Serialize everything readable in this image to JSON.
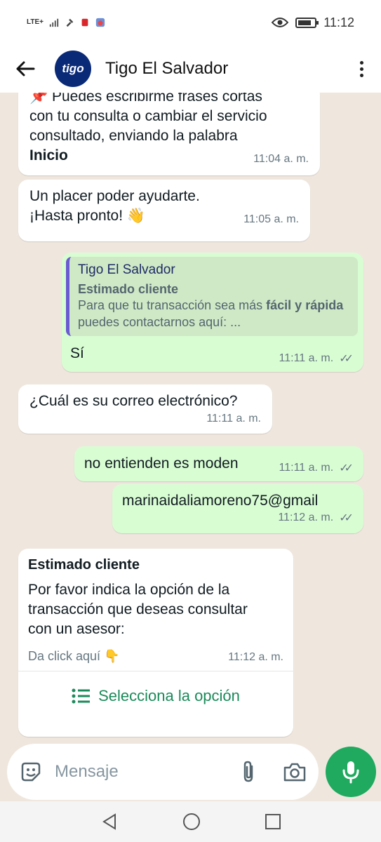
{
  "status_bar": {
    "network": "LTE+",
    "time": "11:12"
  },
  "header": {
    "avatar_text": "tigo",
    "contact_name": "Tigo El Salvador"
  },
  "messages": {
    "m1": {
      "text_line1": "📌 Puedes escribirme frases cortas",
      "text_line2": "con tu consulta o cambiar el servicio",
      "text_line3": "consultado, enviando la palabra",
      "text_bold": "Inicio",
      "time": "11:04 a. m."
    },
    "m2": {
      "text_line1": "Un placer poder ayudarte.",
      "text_line2": "¡Hasta pronto! 👋",
      "time": "11:05 a. m."
    },
    "m3": {
      "quote_author": "Tigo El Salvador",
      "quote_title": "Estimado cliente",
      "quote_body_a": "Para que tu transacción sea más ",
      "quote_body_b": "fácil y",
      "quote_body_c": "rápida",
      "quote_body_d": " puedes contactarnos aquí: ...",
      "text": "Sí",
      "time": "11:11 a. m."
    },
    "m4": {
      "text": "¿Cuál es su correo electrónico?",
      "time": "11:11 a. m."
    },
    "m5": {
      "text": "no entienden es moden",
      "time": "11:11 a. m."
    },
    "m6": {
      "text": "marinaidaliamoreno75@gmail",
      "time": "11:12 a. m."
    },
    "m7": {
      "title": "Estimado cliente",
      "body_line1": "Por favor indica la opción de la",
      "body_line2": "transacción que deseas consultar",
      "body_line3": "con un asesor:",
      "footer": "Da click aquí 👇",
      "time": "11:12 a. m.",
      "option_label": "Selecciona la opción"
    }
  },
  "input": {
    "placeholder": "Mensaje"
  },
  "colors": {
    "accent_green": "#1faa5f",
    "outgoing_bubble": "#d9fdd3",
    "chat_background": "#efe7de",
    "quote_bar": "#6b5bd2"
  }
}
